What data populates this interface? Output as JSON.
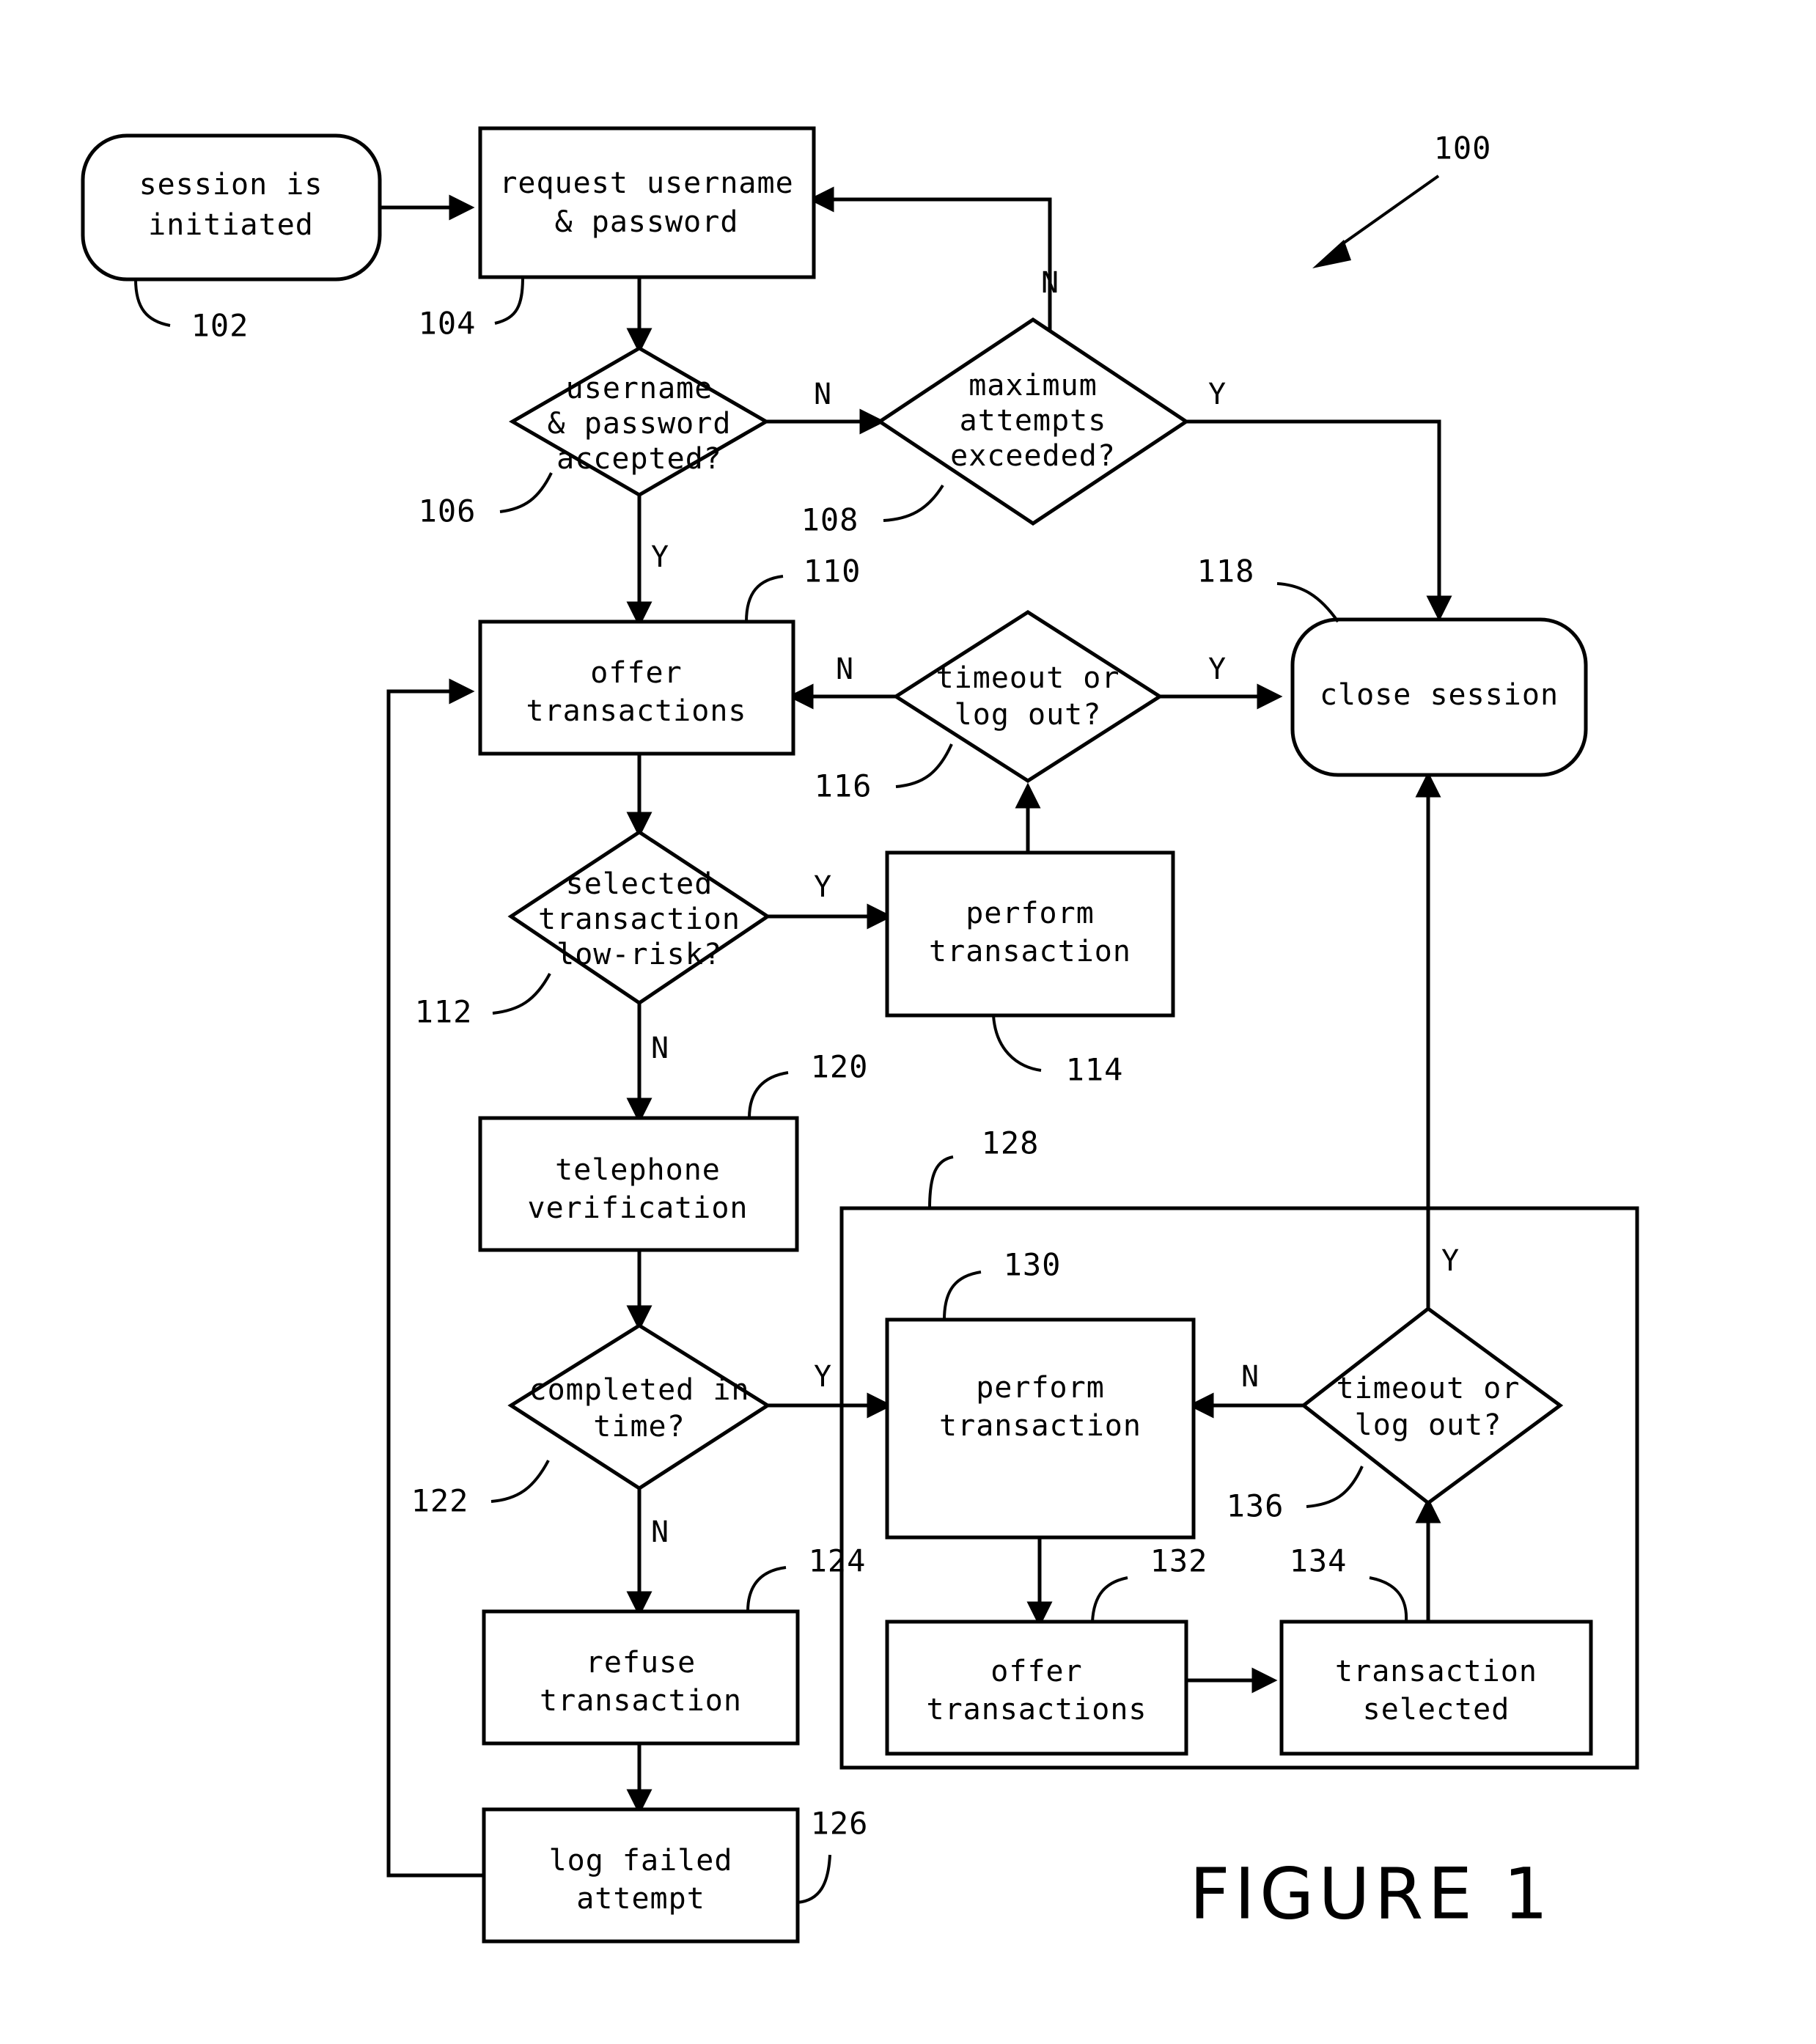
{
  "figure": {
    "caption": "FIGURE 1",
    "overall_ref": "100"
  },
  "nodes": {
    "start": {
      "ref": "102",
      "lines": [
        "session is",
        "initiated"
      ],
      "shape": "rounded"
    },
    "request_credentials": {
      "ref": "104",
      "lines": [
        "request username",
        "& password"
      ],
      "shape": "rect"
    },
    "credentials_accepted": {
      "ref": "106",
      "lines": [
        "username",
        "& password",
        "accepted?"
      ],
      "shape": "diamond"
    },
    "max_attempts": {
      "ref": "108",
      "lines": [
        "maximum",
        "attempts",
        "exceeded?"
      ],
      "shape": "diamond"
    },
    "offer_transactions_1": {
      "ref": "110",
      "lines": [
        "offer",
        "transactions"
      ],
      "shape": "rect"
    },
    "low_risk": {
      "ref": "112",
      "lines": [
        "selected",
        "transaction",
        "low-risk?"
      ],
      "shape": "diamond"
    },
    "perform_transaction_1": {
      "ref": "114",
      "lines": [
        "perform",
        "transaction"
      ],
      "shape": "rect"
    },
    "timeout_or_logout_1": {
      "ref": "116",
      "lines": [
        "timeout or",
        "log out?"
      ],
      "shape": "diamond"
    },
    "close_session": {
      "ref": "118",
      "lines": [
        "close session"
      ],
      "shape": "rounded"
    },
    "telephone_verification": {
      "ref": "120",
      "lines": [
        "telephone",
        "verification"
      ],
      "shape": "rect"
    },
    "completed_in_time": {
      "ref": "122",
      "lines": [
        "completed in",
        "time?"
      ],
      "shape": "diamond"
    },
    "refuse_transaction": {
      "ref": "124",
      "lines": [
        "refuse",
        "transaction"
      ],
      "shape": "rect"
    },
    "log_failed_attempt": {
      "ref": "126",
      "lines": [
        "log failed",
        "attempt"
      ],
      "shape": "rect"
    },
    "trusted_group": {
      "ref": "128",
      "lines": [],
      "shape": "group"
    },
    "perform_transaction_2": {
      "ref": "130",
      "lines": [
        "perform",
        "transaction"
      ],
      "shape": "rect"
    },
    "offer_transactions_2": {
      "ref": "132",
      "lines": [
        "offer",
        "transactions"
      ],
      "shape": "rect"
    },
    "transaction_selected": {
      "ref": "134",
      "lines": [
        "transaction",
        "selected"
      ],
      "shape": "rect"
    },
    "timeout_or_logout_2": {
      "ref": "136",
      "lines": [
        "timeout or",
        "log out?"
      ],
      "shape": "diamond"
    }
  },
  "branch_labels": {
    "credentials_no": "N",
    "credentials_yes": "Y",
    "max_attempts_no": "N",
    "max_attempts_yes": "Y",
    "timeout1_no": "N",
    "timeout1_yes": "Y",
    "low_risk_yes": "Y",
    "low_risk_no": "N",
    "completed_yes": "Y",
    "completed_no": "N",
    "timeout2_no": "N",
    "timeout2_yes": "Y"
  },
  "colors": {
    "stroke": "#000000",
    "fill": "#ffffff"
  }
}
